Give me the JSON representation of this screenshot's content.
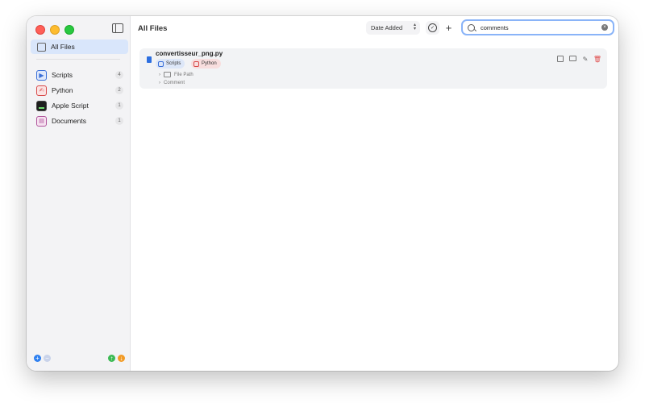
{
  "sidebar": {
    "all_files_label": "All Files",
    "categories": [
      {
        "label": "Scripts",
        "count": "4",
        "icon": "scripts-icon",
        "color": "#3a6fd8"
      },
      {
        "label": "Python",
        "count": "2",
        "icon": "python-icon",
        "color": "#d84a4a"
      },
      {
        "label": "Apple Script",
        "count": "1",
        "icon": "applescript-icon",
        "color": "#222222"
      },
      {
        "label": "Documents",
        "count": "1",
        "icon": "documents-icon",
        "color": "#b0559c"
      }
    ],
    "bottom": {
      "add": "+",
      "remove": "−",
      "upload": "↑",
      "download": "↓"
    }
  },
  "header": {
    "title": "All Files",
    "sort_label": "Date Added",
    "search_value": "comments"
  },
  "results": [
    {
      "file_name": "convertisseur_png.py",
      "tags": [
        "Scripts",
        "Python"
      ],
      "file_path_label": "File Path",
      "comment_label": "Comment"
    }
  ],
  "colors": {
    "accent": "#2d6fe0",
    "selection": "#d9e6fb",
    "close": "#ff5f57",
    "minimize": "#febc2e",
    "zoom": "#28c840"
  }
}
